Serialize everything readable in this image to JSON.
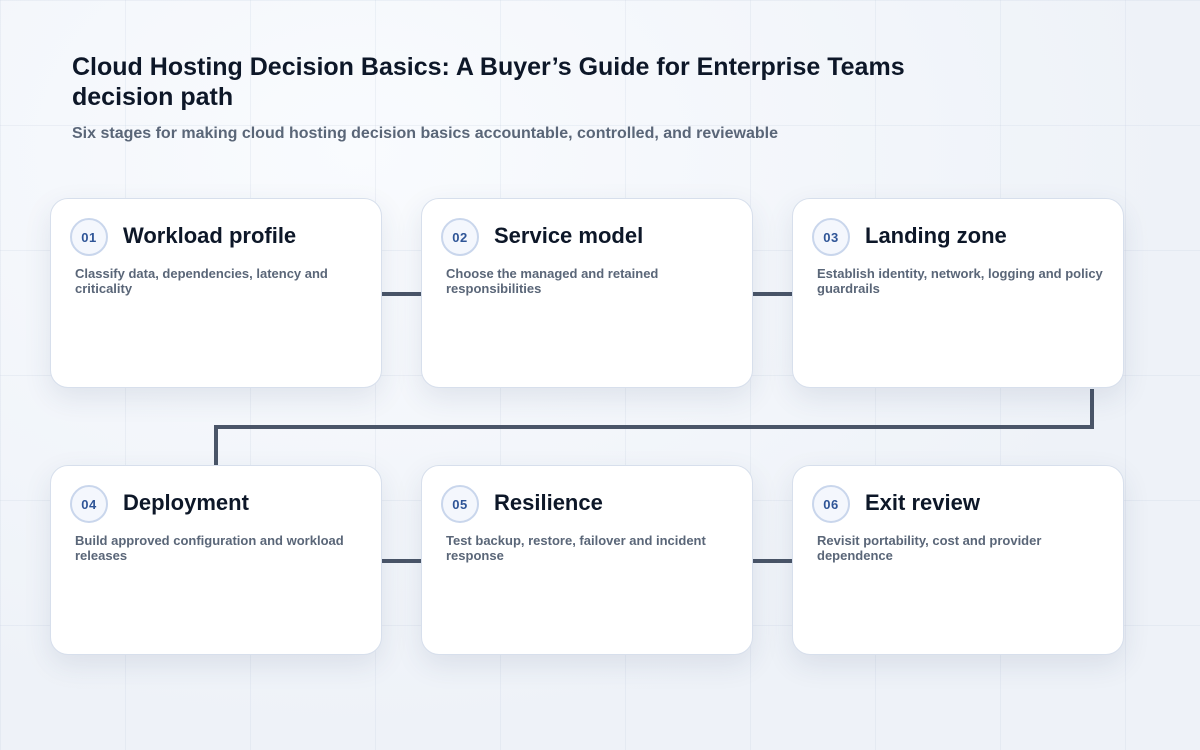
{
  "header": {
    "title": "Cloud Hosting Decision Basics: A Buyer’s Guide for Enterprise Teams decision path",
    "subtitle": "Six stages for making cloud hosting decision basics accountable, controlled, and reviewable"
  },
  "steps": [
    {
      "number": "01",
      "title": "Workload profile",
      "description": "Classify data, dependencies, latency and criticality"
    },
    {
      "number": "02",
      "title": "Service model",
      "description": "Choose the managed and retained responsibilities"
    },
    {
      "number": "03",
      "title": "Landing zone",
      "description": "Establish identity, network, logging and policy guardrails"
    },
    {
      "number": "04",
      "title": "Deployment",
      "description": "Build approved configuration and workload releases"
    },
    {
      "number": "05",
      "title": "Resilience",
      "description": "Test backup, restore, failover and incident response"
    },
    {
      "number": "06",
      "title": "Exit review",
      "description": "Revisit portability, cost and provider dependence"
    }
  ],
  "colors": {
    "connector": "#4a5568",
    "accent": "#2f5597"
  }
}
